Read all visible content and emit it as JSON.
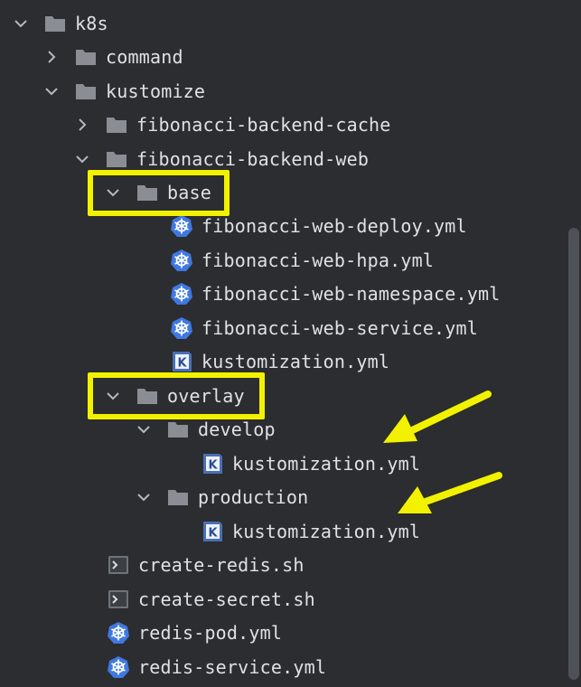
{
  "colors": {
    "background": "#2b2d30",
    "text": "#dfe1e5",
    "folder": "#8a8d93",
    "k8s_icon": "#3f78e0",
    "kustomize_icon": "#4a6fb5",
    "highlight": "#f2f200"
  },
  "tree": [
    {
      "label": "k8s",
      "icon": "folder-icon",
      "expanded": true
    },
    {
      "label": "command",
      "icon": "folder-icon",
      "expanded": false
    },
    {
      "label": "kustomize",
      "icon": "folder-icon",
      "expanded": true
    },
    {
      "label": "fibonacci-backend-cache",
      "icon": "folder-icon",
      "expanded": false
    },
    {
      "label": "fibonacci-backend-web",
      "icon": "folder-icon",
      "expanded": true
    },
    {
      "label": "base",
      "icon": "folder-icon",
      "expanded": true,
      "highlighted": true
    },
    {
      "label": "fibonacci-web-deploy.yml",
      "icon": "kubernetes-icon"
    },
    {
      "label": "fibonacci-web-hpa.yml",
      "icon": "kubernetes-icon"
    },
    {
      "label": "fibonacci-web-namespace.yml",
      "icon": "kubernetes-icon"
    },
    {
      "label": "fibonacci-web-service.yml",
      "icon": "kubernetes-icon"
    },
    {
      "label": "kustomization.yml",
      "icon": "kustomize-icon",
      "badge": "K"
    },
    {
      "label": "overlay",
      "icon": "folder-icon",
      "expanded": true,
      "highlighted": true
    },
    {
      "label": "develop",
      "icon": "folder-icon",
      "expanded": true
    },
    {
      "label": "kustomization.yml",
      "icon": "kustomize-icon",
      "badge": "K",
      "arrow": true
    },
    {
      "label": "production",
      "icon": "folder-icon",
      "expanded": true
    },
    {
      "label": "kustomization.yml",
      "icon": "kustomize-icon",
      "badge": "K",
      "arrow": true
    },
    {
      "label": "create-redis.sh",
      "icon": "shell-script-icon"
    },
    {
      "label": "create-secret.sh",
      "icon": "shell-script-icon"
    },
    {
      "label": "redis-pod.yml",
      "icon": "kubernetes-icon"
    },
    {
      "label": "redis-service.yml",
      "icon": "kubernetes-icon"
    }
  ]
}
